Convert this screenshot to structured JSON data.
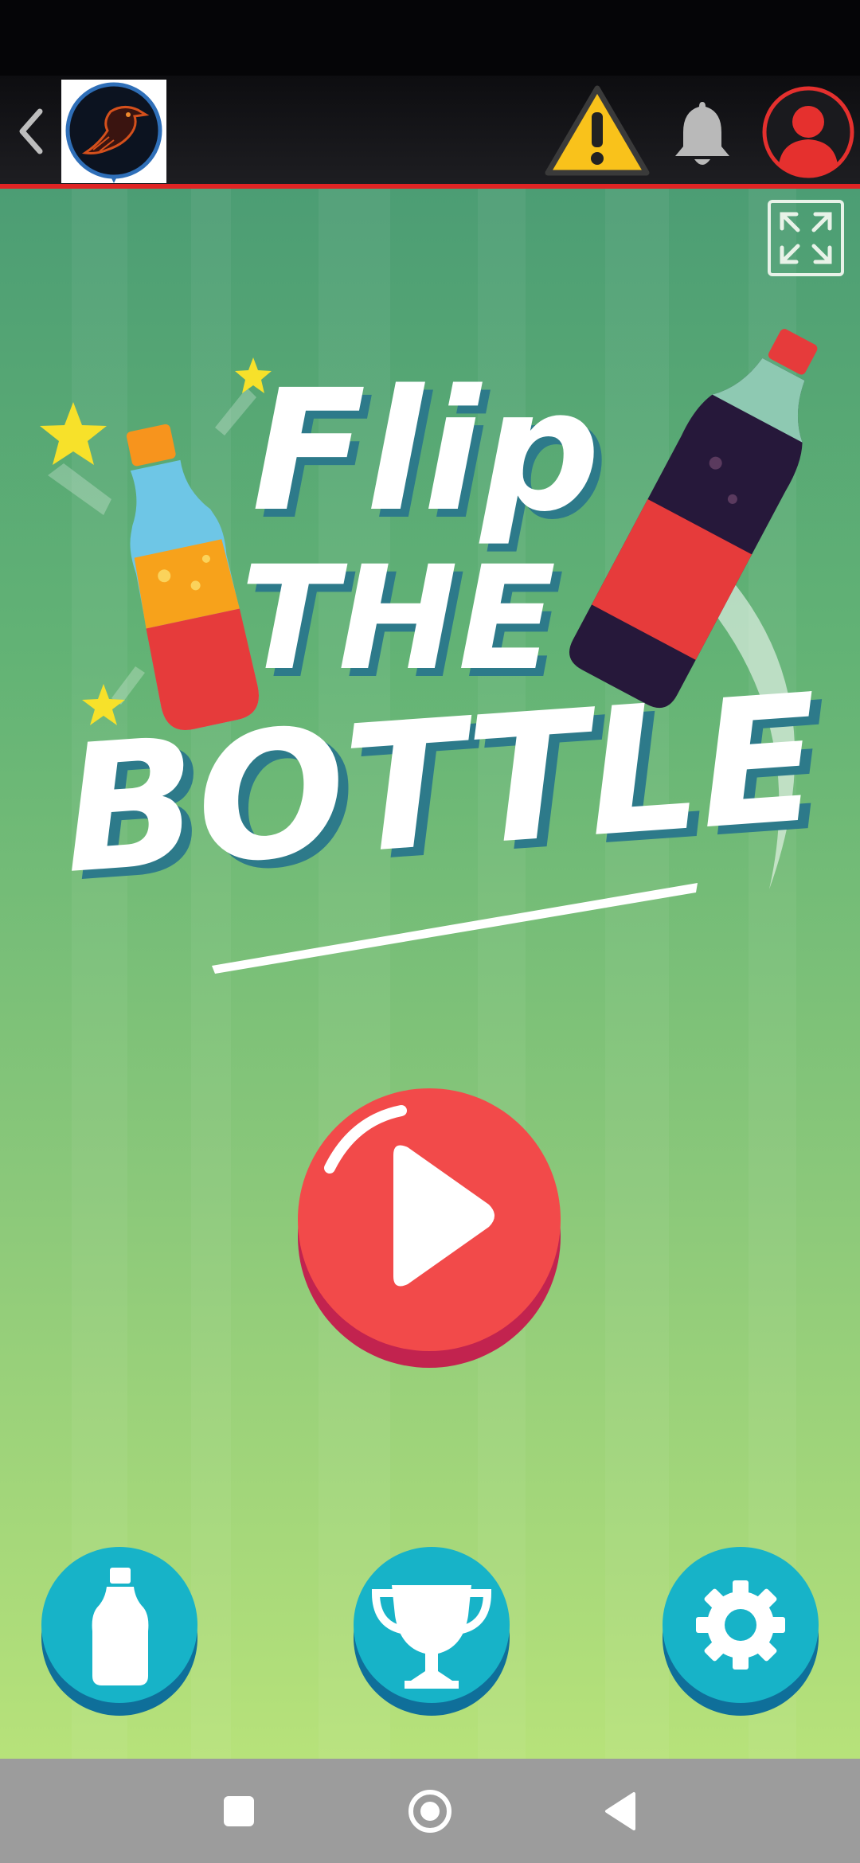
{
  "title": {
    "line1": "Flip",
    "line2": "THE",
    "line3": "BOTTLE"
  },
  "icons": {
    "back": "chevron-left-icon",
    "warning": "warning-icon",
    "bell": "bell-icon",
    "profile": "user-icon",
    "fullscreen": "expand-icon",
    "play": "play-icon",
    "bottles": "bottle-icon",
    "leaderboard": "trophy-icon",
    "settings": "gear-icon"
  },
  "colors": {
    "accent_red": "#f24a4a",
    "button_teal": "#17b3c8",
    "title_shadow": "#2d7a8a",
    "app_bar_line": "#e02424"
  }
}
